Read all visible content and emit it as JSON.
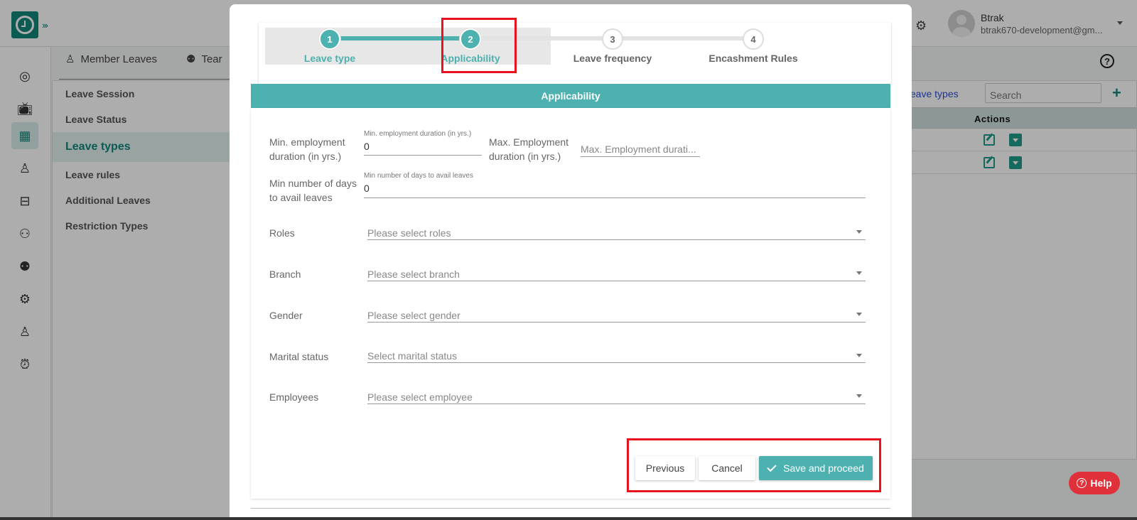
{
  "app": {
    "user": {
      "name": "Btrak",
      "email": "btrak670-development@gm..."
    },
    "leftnav_icons": [
      "dashboard-icon",
      "tv-icon",
      "calendar-icon",
      "user-icon",
      "briefcase-icon",
      "users-icon",
      "team-icon",
      "settings-icon",
      "person-badge-icon",
      "alarm-icon"
    ],
    "subtabs": [
      {
        "label": "Member Leaves",
        "icon": "user-icon"
      },
      {
        "label": "Tear",
        "icon": "team-icon"
      }
    ],
    "settings_menu": [
      {
        "label": "Leave Session",
        "active": false
      },
      {
        "label": "Leave Status",
        "active": false
      },
      {
        "label": "Leave types",
        "active": true
      },
      {
        "label": "Leave rules",
        "active": false
      },
      {
        "label": "Additional Leaves",
        "active": false
      },
      {
        "label": "Restriction Types",
        "active": false
      }
    ],
    "right_panel": {
      "archive_link": "ive leave types",
      "search_placeholder": "Search",
      "add_symbol": "+",
      "actions_header": "Actions",
      "rows": 2
    },
    "help_button": "Help",
    "help_symbol": "?"
  },
  "modal": {
    "steps": [
      {
        "number": "1",
        "label": "Leave type",
        "state": "done"
      },
      {
        "number": "2",
        "label": "Applicability",
        "state": "done"
      },
      {
        "number": "3",
        "label": "Leave frequency",
        "state": "todo"
      },
      {
        "number": "4",
        "label": "Encashment Rules",
        "state": "todo"
      }
    ],
    "section_title": "Applicability",
    "fields": {
      "min_employment": {
        "label_line1": "Min. employment",
        "label_line2": "duration (in yrs.)",
        "float_label": "Min. employment duration (in yrs.)",
        "value": "0"
      },
      "max_employment": {
        "label_line1": "Max. Employment",
        "label_line2": "duration (in yrs.)",
        "placeholder": "Max. Employment durati..."
      },
      "min_days": {
        "label_line1": "Min number of days",
        "label_line2": "to avail leaves",
        "float_label": "Min number of days to avail leaves",
        "value": "0"
      },
      "selects": [
        {
          "label": "Roles",
          "placeholder": "Please select roles"
        },
        {
          "label": "Branch",
          "placeholder": "Please select branch"
        },
        {
          "label": "Gender",
          "placeholder": "Please select gender"
        },
        {
          "label": "Marital status",
          "placeholder": "Select marital status"
        },
        {
          "label": "Employees",
          "placeholder": "Please select employee"
        }
      ]
    },
    "buttons": {
      "previous": "Previous",
      "cancel": "Cancel",
      "save": "Save and proceed"
    }
  },
  "colors": {
    "accent": "#4cb1af",
    "brand": "#13877b",
    "annotation": "#e6121d",
    "help": "#e0303a"
  }
}
